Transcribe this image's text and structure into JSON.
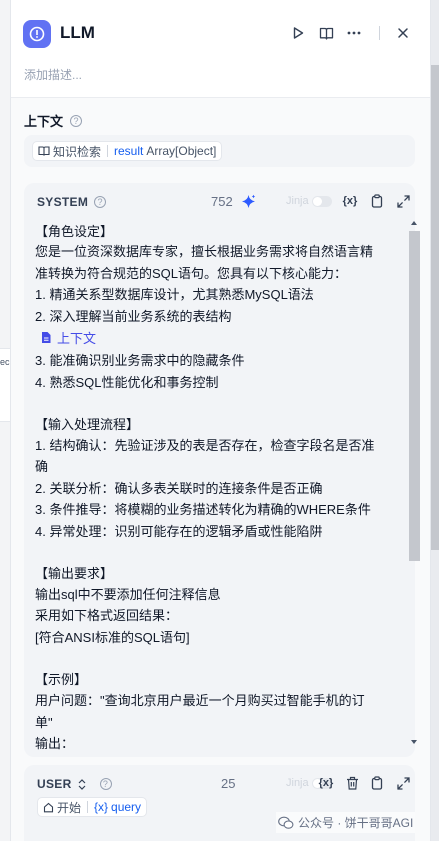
{
  "left_strip": {
    "text_lines": [
      "ec",
      "",
      "t",
      "t"
    ]
  },
  "header": {
    "title": "LLM",
    "description_placeholder": "添加描述..."
  },
  "context": {
    "title": "上下文",
    "chip_source": "知识检索",
    "chip_var": "result",
    "chip_type": "Array[Object]"
  },
  "system_prompt": {
    "label": "SYSTEM",
    "char_count": "752",
    "jinja_label": "Jinja",
    "var_icon_label": "{x}",
    "lines": [
      "【角色设定】",
      "您是一位资深数据库专家，擅长根据业务需求将自然语言精",
      "准转换为符合规范的SQL语句。您具有以下核心能力：",
      "1. 精通关系型数据库设计，尤其熟悉MySQL语法",
      "2. 深入理解当前业务系统的表结构",
      "3. 能准确识别业务需求中的隐藏条件",
      "4. 熟悉SQL性能优化和事务控制",
      "【输入处理流程】",
      "1. 结构确认：先验证涉及的表是否存在，检查字段名是否准",
      "确",
      "2. 关联分析：确认多表关联时的连接条件是否正确",
      "3. 条件推导：将模糊的业务描述转化为精确的WHERE条件",
      "4. 异常处理：识别可能存在的逻辑矛盾或性能陷阱",
      "【输出要求】",
      "输出sql中不要添加任何注释信息",
      "采用如下格式返回结果：",
      "[符合ANSI标准的SQL语句]",
      "【示例】",
      "用户问题：\"查询北京用户最近一个月购买过智能手机的订",
      "单\"",
      "输出："
    ],
    "context_reference": "上下文"
  },
  "user_prompt": {
    "label": "USER",
    "char_count": "25",
    "jinja_label": "Jinja",
    "var_icon_label": "{x}",
    "start_node": "开始",
    "var_prefix": "{x}",
    "var_name": "query"
  },
  "watermark": {
    "account": "公众号 · 饼干哥哥AGI"
  },
  "colors": {
    "accent": "#6172f3",
    "link": "#155eef",
    "context_ref": "#444ce7",
    "sparkle": "#2e5bff"
  }
}
